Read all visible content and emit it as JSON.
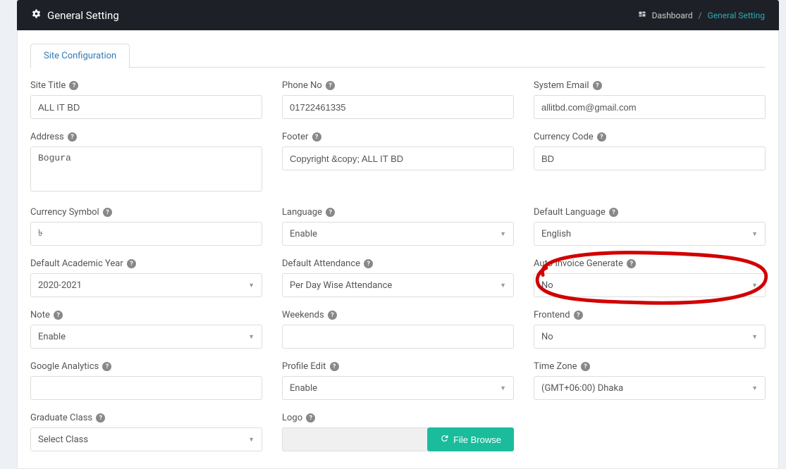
{
  "header": {
    "title": "General Setting",
    "breadcrumb_dashboard": "Dashboard",
    "breadcrumb_current": "General Setting"
  },
  "tabs": {
    "site_config": "Site Configuration"
  },
  "labels": {
    "site_title": "Site Title",
    "phone_no": "Phone No",
    "system_email": "System Email",
    "address": "Address",
    "footer": "Footer",
    "currency_code": "Currency Code",
    "currency_symbol": "Currency Symbol",
    "language": "Language",
    "default_language": "Default Language",
    "default_academic_year": "Default Academic Year",
    "default_attendance": "Default Attendance",
    "auto_invoice_generate": "Auto Invoice Generate",
    "note": "Note",
    "weekends": "Weekends",
    "frontend": "Frontend",
    "google_analytics": "Google Analytics",
    "profile_edit": "Profile Edit",
    "time_zone": "Time Zone",
    "graduate_class": "Graduate Class",
    "logo": "Logo"
  },
  "values": {
    "site_title": "ALL IT BD",
    "phone_no": "01722461335",
    "system_email": "allitbd.com@gmail.com",
    "address": "Bogura",
    "footer": "Copyright &copy; ALL IT BD",
    "currency_code": "BD",
    "currency_symbol": "৳",
    "language": "Enable",
    "default_language": "English",
    "default_academic_year": "2020-2021",
    "default_attendance": "Per Day Wise Attendance",
    "auto_invoice_generate": "No",
    "note": "Enable",
    "weekends": "",
    "frontend": "No",
    "google_analytics": "",
    "profile_edit": "Enable",
    "time_zone": "(GMT+06:00) Dhaka",
    "graduate_class": "Select Class",
    "file_browse": "File Browse"
  }
}
